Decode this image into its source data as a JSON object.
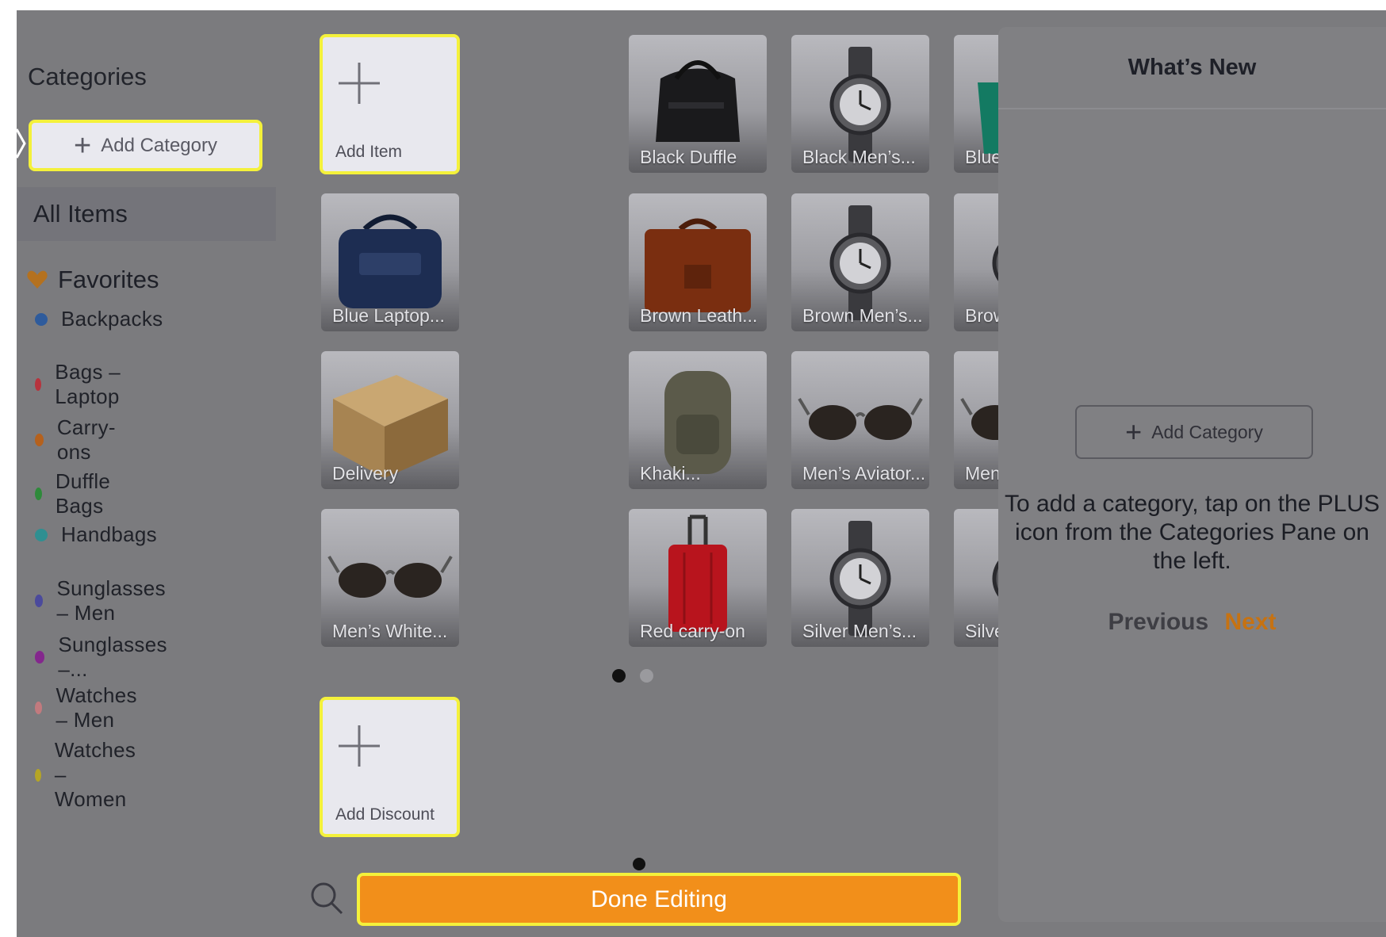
{
  "sidebar": {
    "title": "Categories",
    "add_category_label": "Add Category",
    "all_items_label": "All Items",
    "favorites_label": "Favorites",
    "categories": [
      {
        "label": "Backpacks",
        "color": "#2e5b9c"
      },
      {
        "label": "Bags – Laptop",
        "color": "#b7333d"
      },
      {
        "label": "Carry-ons",
        "color": "#b5611d"
      },
      {
        "label": "Duffle Bags",
        "color": "#2e8a3a"
      },
      {
        "label": "Handbags",
        "color": "#2f8f91"
      },
      {
        "label": "Sunglasses – Men",
        "color": "#4b4a9c"
      },
      {
        "label": "Sunglasses –...",
        "color": "#84278d"
      },
      {
        "label": "Watches – Men",
        "color": "#c27a7e"
      },
      {
        "label": "Watches – Women",
        "color": "#b5a525"
      }
    ]
  },
  "grid": {
    "add_item_label": "Add Item",
    "add_discount_label": "Add Discount",
    "items": [
      {
        "label": "Black Duffle",
        "icon": "duffle-bag-icon"
      },
      {
        "label": "Black Men’s...",
        "icon": "watch-icon"
      },
      {
        "label": "Blue Handbag",
        "icon": "handbag-icon"
      },
      {
        "label": "Blue Laptop...",
        "icon": "laptop-bag-icon"
      },
      {
        "label": "Brown Leath...",
        "icon": "briefcase-icon"
      },
      {
        "label": "Brown Men’s...",
        "icon": "watch-icon"
      },
      {
        "label": "Brown...",
        "icon": "watch-icon"
      },
      {
        "label": "Delivery",
        "icon": "box-icon"
      },
      {
        "label": "Khaki...",
        "icon": "backpack-icon"
      },
      {
        "label": "Men’s Aviator...",
        "icon": "sunglasses-icon"
      },
      {
        "label": "Men’s Black...",
        "icon": "sunglasses-icon"
      },
      {
        "label": "Men’s White...",
        "icon": "sunglasses-icon"
      },
      {
        "label": "Red carry-on",
        "icon": "suitcase-icon"
      },
      {
        "label": "Silver Men’s...",
        "icon": "watch-icon"
      },
      {
        "label": "Silver...",
        "icon": "watch-icon"
      }
    ],
    "page_indicator": {
      "pages": 2,
      "current": 1
    }
  },
  "toolbar": {
    "done_label": "Done Editing"
  },
  "whats_new": {
    "title": "What’s New",
    "add_category_label": "Add Category",
    "message": "To add a category, tap on the PLUS icon from the Categories Pane on the left.",
    "previous_label": "Previous",
    "next_label": "Next"
  },
  "colors": {
    "highlight": "#f4f13b",
    "accent_orange": "#f28f1a",
    "overlay_gray": "#7b7b7e"
  }
}
